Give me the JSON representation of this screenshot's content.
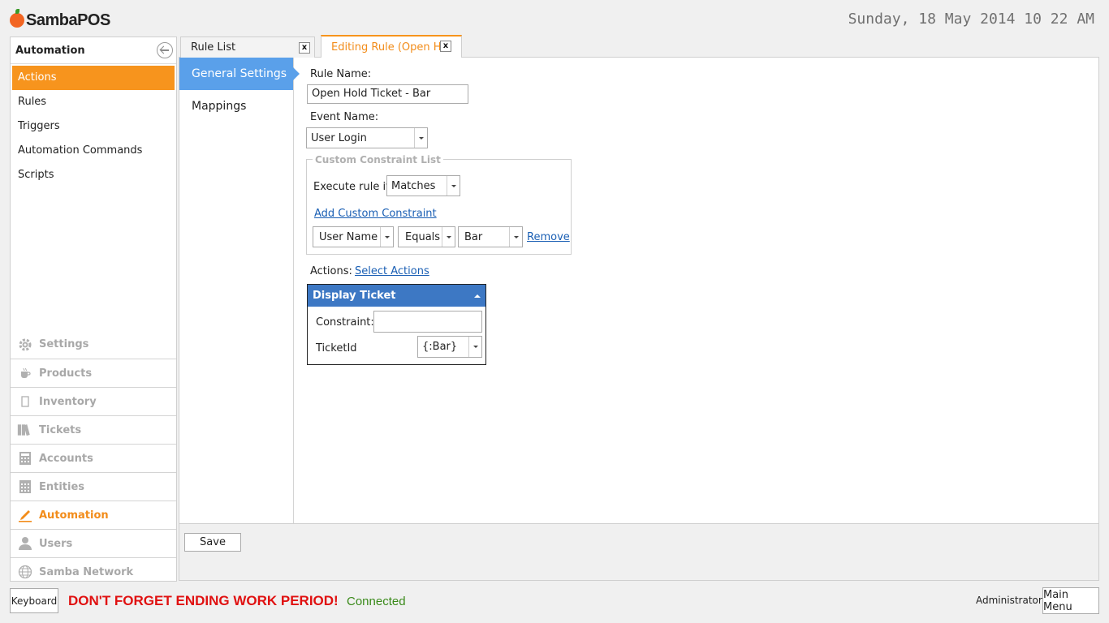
{
  "header": {
    "logo_text": "SambaPOS",
    "datetime": "Sunday, 18 May 2014 10 22 AM"
  },
  "sidebar": {
    "title": "Automation",
    "sub_items": [
      {
        "label": "Actions",
        "active": true
      },
      {
        "label": "Rules",
        "active": false
      },
      {
        "label": "Triggers",
        "active": false
      },
      {
        "label": "Automation Commands",
        "active": false
      },
      {
        "label": "Scripts",
        "active": false
      }
    ],
    "modules": [
      {
        "label": "Settings",
        "icon": "gear-icon"
      },
      {
        "label": "Products",
        "icon": "coffee-cup-icon"
      },
      {
        "label": "Inventory",
        "icon": "box-icon"
      },
      {
        "label": "Tickets",
        "icon": "books-icon"
      },
      {
        "label": "Accounts",
        "icon": "calculator-icon"
      },
      {
        "label": "Entities",
        "icon": "grid-icon"
      },
      {
        "label": "Automation",
        "icon": "pencil-icon",
        "active": true
      },
      {
        "label": "Users",
        "icon": "user-icon"
      },
      {
        "label": "Samba Network",
        "icon": "globe-icon"
      }
    ]
  },
  "tabs": {
    "rule_list": "Rule List",
    "editing_rule": "Editing Rule (Open Ho",
    "close": "x"
  },
  "settings_nav": {
    "general": "General Settings",
    "mappings": "Mappings"
  },
  "form": {
    "rule_name_label": "Rule Name:",
    "rule_name_value": "Open Hold Ticket - Bar",
    "event_name_label": "Event Name:",
    "event_name_value": "User Login",
    "constraint_group_title": "Custom Constraint List",
    "execute_rule_label": "Execute rule if",
    "execute_rule_value": "Matches",
    "add_constraint_link": "Add Custom Constraint",
    "constraint_field": "User Name",
    "constraint_operator": "Equals",
    "constraint_value": "Bar",
    "remove_link": "Remove",
    "actions_label": "Actions:",
    "select_actions_link": "Select Actions"
  },
  "action_card": {
    "title": "Display Ticket",
    "constraint_label": "Constraint:",
    "constraint_value": "",
    "ticketid_label": "TicketId",
    "ticketid_value": "{:Bar}"
  },
  "footer": {
    "save": "Save",
    "keyboard": "Keyboard",
    "warning": "DON'T FORGET ENDING WORK PERIOD!",
    "status": "Connected",
    "user": "Administrator",
    "main_menu": "Main Menu"
  }
}
